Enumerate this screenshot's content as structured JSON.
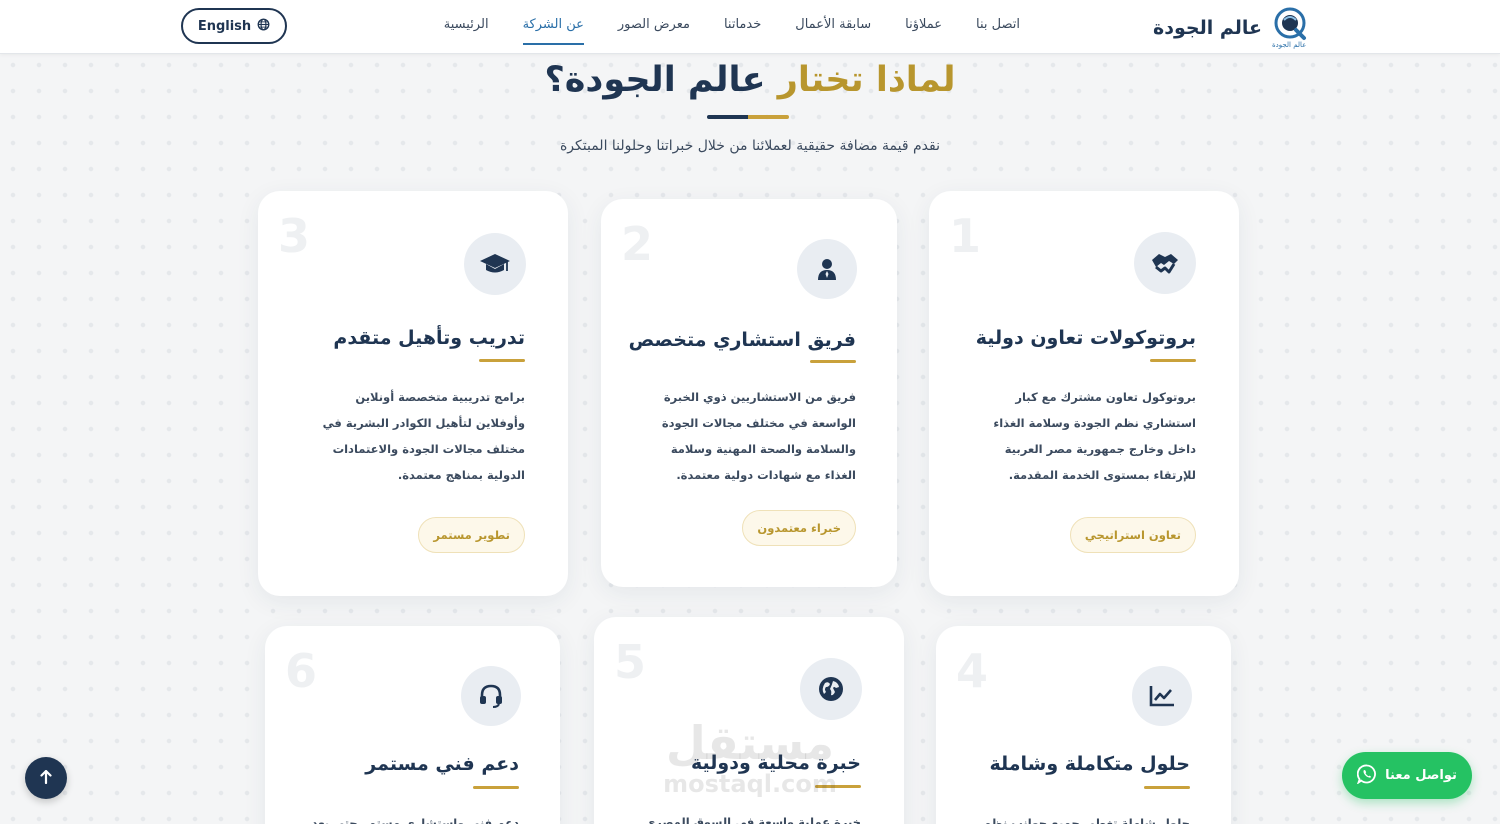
{
  "header": {
    "brand_name": "عالم الجودة",
    "brand_logo_caption": "عالم الجودة",
    "nav": [
      {
        "label": "الرئيسية",
        "active": false
      },
      {
        "label": "عن الشركة",
        "active": true
      },
      {
        "label": "معرض الصور",
        "active": false
      },
      {
        "label": "خدماتنا",
        "active": false
      },
      {
        "label": "سابقة الأعمال",
        "active": false
      },
      {
        "label": "عملاؤنا",
        "active": false
      },
      {
        "label": "اتصل بنا",
        "active": false
      }
    ],
    "lang_button": "English",
    "lang_icon": "globe-icon"
  },
  "section": {
    "title_part1": "لماذا تختار",
    "title_part2": "عالم الجودة؟",
    "subtitle": "نقدم قيمة مضافة حقيقية لعملائنا من خلال خبراتنا وحلولنا المبتكرة"
  },
  "colors": {
    "navy": "#1f3552",
    "gold": "#c9a13b",
    "active_link": "#2a6fa8",
    "whatsapp": "#25c263"
  },
  "cards": [
    {
      "number": "1",
      "icon": "handshake-icon",
      "title": "بروتوكولات تعاون دولية",
      "description": "بروتوكول تعاون مشترك مع كبار استشاري نظم الجودة وسلامة الغذاء داخل وخارج جمهورية مصر العربية للإرتقاء بمستوى الخدمة المقدمة.",
      "badge": "تعاون استراتيجي"
    },
    {
      "number": "2",
      "icon": "user-tie-icon",
      "title": "فريق استشاري متخصص",
      "description": "فريق من الاستشاريين ذوي الخبرة الواسعة في مختلف مجالات الجودة والسلامة والصحة المهنية وسلامة الغذاء مع شهادات دولية معتمدة.",
      "badge": "خبراء معتمدون"
    },
    {
      "number": "3",
      "icon": "graduation-cap-icon",
      "title": "تدريب وتأهيل متقدم",
      "description": "برامج تدريبية متخصصة أونلاين وأوفلاين لتأهيل الكوادر البشرية في مختلف مجالات الجودة والاعتمادات الدولية بمناهج معتمدة.",
      "badge": "تطوير مستمر"
    },
    {
      "number": "4",
      "icon": "chart-line-icon",
      "title": "حلول متكاملة وشاملة",
      "description": "حلول شاملة تغطي جميع جوانب نظم الإدارة",
      "badge": ""
    },
    {
      "number": "5",
      "icon": "globe-icon",
      "title": "خبرة محلية ودولية",
      "description": "خبرة عملية واسعة في السوق المصري",
      "badge": ""
    },
    {
      "number": "6",
      "icon": "headset-icon",
      "title": "دعم فني مستمر",
      "description": "دعم فني واستشاري مستمر حتى بعد اتمام",
      "badge": ""
    }
  ],
  "floating": {
    "whatsapp_label": "تواصل معنا",
    "whatsapp_icon": "whatsapp-icon",
    "scroll_top_icon": "arrow-up-icon"
  },
  "watermark": {
    "line1": "مستقل",
    "line2": "mostaql.com"
  }
}
